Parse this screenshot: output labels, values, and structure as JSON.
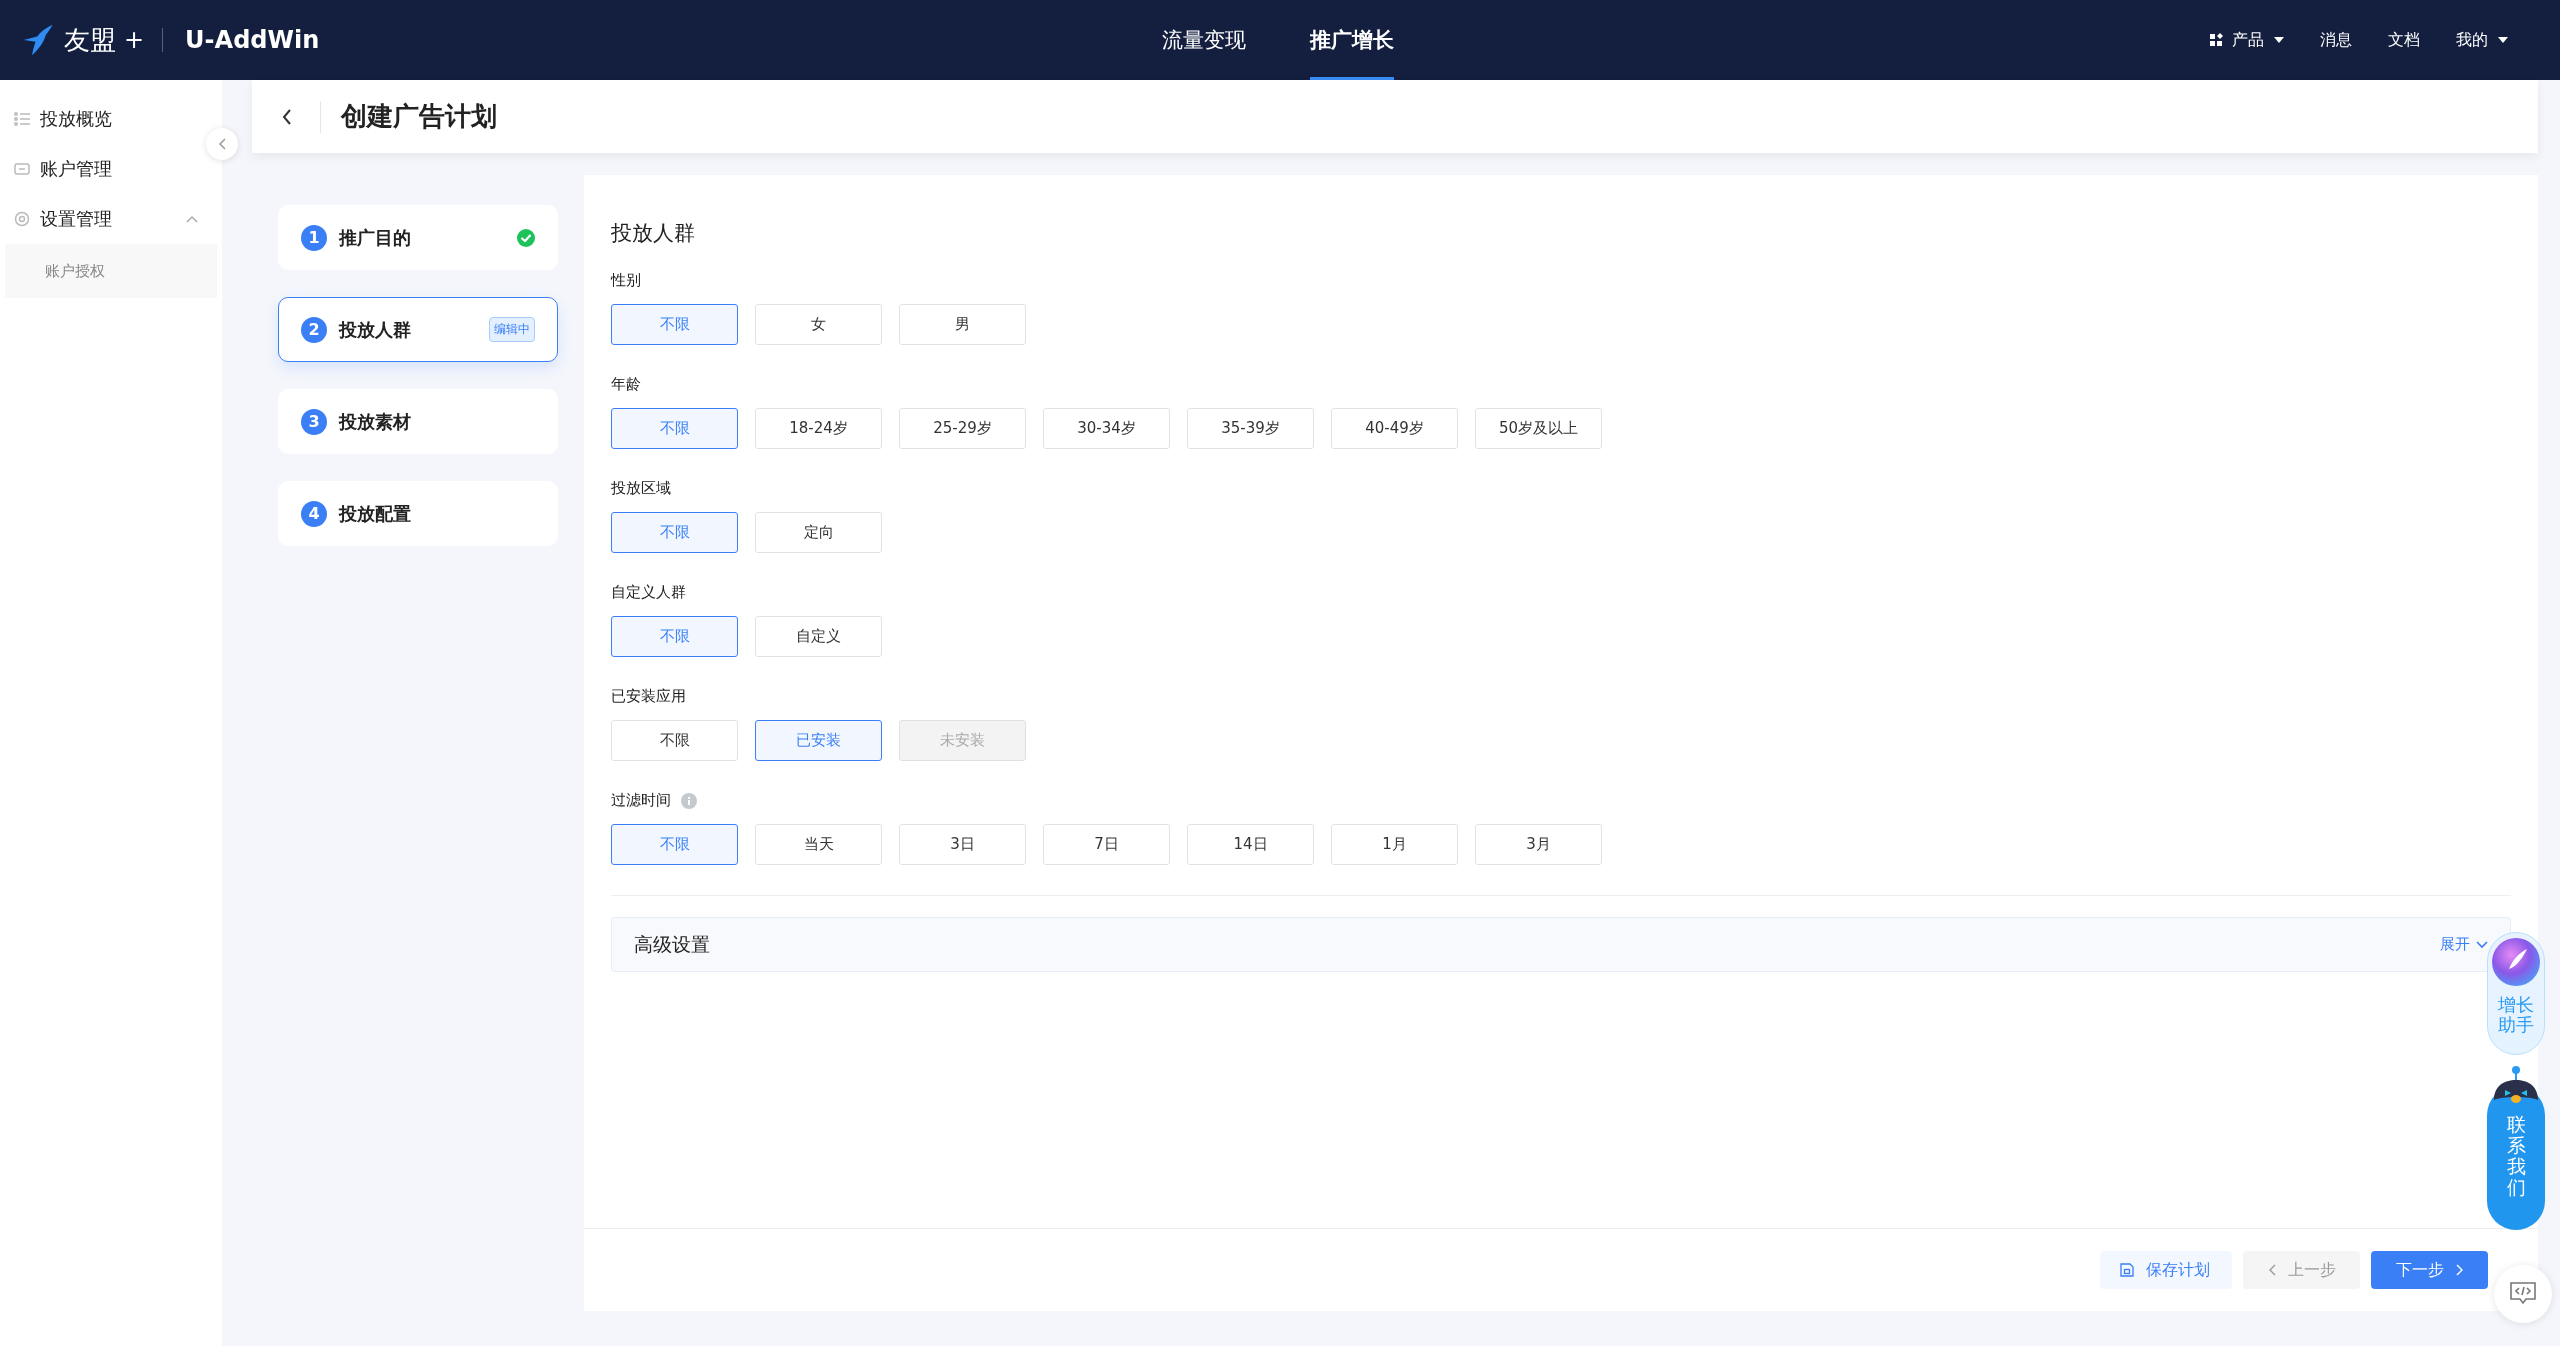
{
  "topbar": {
    "brand": "友盟",
    "brand_plus": "+",
    "product": "U-AddWin",
    "tabs": [
      {
        "label": "流量变现",
        "selected": false
      },
      {
        "label": "推广增长",
        "selected": true
      }
    ],
    "links": [
      {
        "label": "产品",
        "kind": "grid-menu"
      },
      {
        "label": "消息",
        "kind": "plain"
      },
      {
        "label": "文档",
        "kind": "plain"
      },
      {
        "label": "我的",
        "kind": "menu"
      }
    ]
  },
  "sidebar": {
    "items": [
      {
        "label": "投放概览",
        "kind": "list"
      },
      {
        "label": "账户管理",
        "kind": "card"
      },
      {
        "label": "设置管理",
        "kind": "gear",
        "expanded": true,
        "children": [
          {
            "label": "账户授权"
          }
        ]
      }
    ]
  },
  "header": {
    "title": "创建广告计划"
  },
  "steps": [
    {
      "number": "1",
      "label": "推广目的",
      "done": true,
      "selected": false
    },
    {
      "number": "2",
      "label": "投放人群",
      "badge": "编辑中",
      "done": false,
      "selected": true
    },
    {
      "number": "3",
      "label": "投放素材",
      "done": false,
      "selected": false
    },
    {
      "number": "4",
      "label": "投放配置",
      "done": false,
      "selected": false
    }
  ],
  "form": {
    "title": "投放人群",
    "groups": [
      {
        "label": "性别",
        "options": [
          {
            "label": "不限",
            "selected": true,
            "disabled": false
          },
          {
            "label": "女",
            "selected": false,
            "disabled": false
          },
          {
            "label": "男",
            "selected": false,
            "disabled": false
          }
        ]
      },
      {
        "label": "年龄",
        "options": [
          {
            "label": "不限",
            "selected": true,
            "disabled": false
          },
          {
            "label": "18-24岁",
            "selected": false,
            "disabled": false
          },
          {
            "label": "25-29岁",
            "selected": false,
            "disabled": false
          },
          {
            "label": "30-34岁",
            "selected": false,
            "disabled": false
          },
          {
            "label": "35-39岁",
            "selected": false,
            "disabled": false
          },
          {
            "label": "40-49岁",
            "selected": false,
            "disabled": false
          },
          {
            "label": "50岁及以上",
            "selected": false,
            "disabled": false
          }
        ]
      },
      {
        "label": "投放区域",
        "options": [
          {
            "label": "不限",
            "selected": true,
            "disabled": false
          },
          {
            "label": "定向",
            "selected": false,
            "disabled": false
          }
        ]
      },
      {
        "label": "自定义人群",
        "options": [
          {
            "label": "不限",
            "selected": true,
            "disabled": false
          },
          {
            "label": "自定义",
            "selected": false,
            "disabled": false
          }
        ]
      },
      {
        "label": "已安装应用",
        "options": [
          {
            "label": "不限",
            "selected": false,
            "disabled": false
          },
          {
            "label": "已安装",
            "selected": true,
            "disabled": false
          },
          {
            "label": "未安装",
            "selected": false,
            "disabled": true
          }
        ]
      },
      {
        "label": "过滤时间",
        "info": true,
        "options": [
          {
            "label": "不限",
            "selected": true,
            "disabled": false
          },
          {
            "label": "当天",
            "selected": false,
            "disabled": false
          },
          {
            "label": "3日",
            "selected": false,
            "disabled": false
          },
          {
            "label": "7日",
            "selected": false,
            "disabled": false
          },
          {
            "label": "14日",
            "selected": false,
            "disabled": false
          },
          {
            "label": "1月",
            "selected": false,
            "disabled": false
          },
          {
            "label": "3月",
            "selected": false,
            "disabled": false
          }
        ]
      }
    ],
    "advanced": {
      "title": "高级设置",
      "toggle": "展开",
      "expanded": false
    }
  },
  "footer": {
    "save": "保存计划",
    "prev": "上一步",
    "next": "下一步"
  },
  "widgets": {
    "assistant": "增长助手",
    "contact": "联系我们"
  }
}
